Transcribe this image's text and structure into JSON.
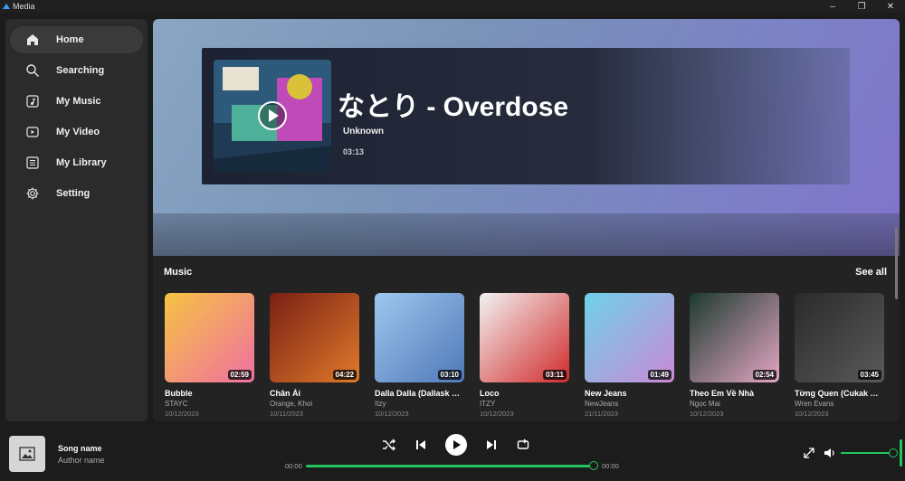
{
  "window": {
    "title": "Media"
  },
  "sidebar": {
    "items": [
      {
        "label": "Home",
        "icon": "home-icon",
        "active": true
      },
      {
        "label": "Searching",
        "icon": "search-icon"
      },
      {
        "label": "My Music",
        "icon": "music-note-icon"
      },
      {
        "label": "My Video",
        "icon": "video-icon"
      },
      {
        "label": "My Library",
        "icon": "library-icon"
      },
      {
        "label": "Setting",
        "icon": "gear-icon"
      }
    ]
  },
  "hero": {
    "title": "なとり - Overdose",
    "artist": "Unknown",
    "duration": "03:13"
  },
  "music": {
    "section_title": "Music",
    "see_all": "See all",
    "cards": [
      {
        "title": "Bubble",
        "artist": "STAYC",
        "date": "10/12/2023",
        "duration": "02:59",
        "colors": [
          "#f6c343",
          "#ef6fa0"
        ]
      },
      {
        "title": "Chân Ái",
        "artist": "Orange, Khoi",
        "date": "10/11/2023",
        "duration": "04:22",
        "colors": [
          "#7a1f14",
          "#e07a2b"
        ]
      },
      {
        "title": "Dalla Dalla (Dallask R...",
        "artist": "Itzy",
        "date": "10/12/2023",
        "duration": "03:10",
        "colors": [
          "#9fc7ee",
          "#4f78b8"
        ]
      },
      {
        "title": "Loco",
        "artist": "ITZY",
        "date": "10/12/2023",
        "duration": "03:11",
        "colors": [
          "#f2f2f2",
          "#d12a2a"
        ]
      },
      {
        "title": "New Jeans",
        "artist": "NewJeans",
        "date": "21/11/2023",
        "duration": "01:49",
        "colors": [
          "#6fd1e8",
          "#c98ad6"
        ]
      },
      {
        "title": "Theo Em Về Nhà",
        "artist": "Ngọc Mai",
        "date": "10/12/2023",
        "duration": "02:54",
        "colors": [
          "#1d3a2f",
          "#e4a6c4"
        ]
      },
      {
        "title": "Từng Quen (Cukak Re...",
        "artist": "Wren Evans",
        "date": "10/12/2023",
        "duration": "03:45",
        "colors": [
          "#2a2a2a",
          "#5a5a5a"
        ]
      }
    ]
  },
  "player": {
    "song_name": "Song name",
    "author_name": "Author name",
    "time_current": "00:00",
    "time_total": "00:00",
    "progress": 1.0,
    "volume": 1.0,
    "accent": "#22c55e"
  }
}
